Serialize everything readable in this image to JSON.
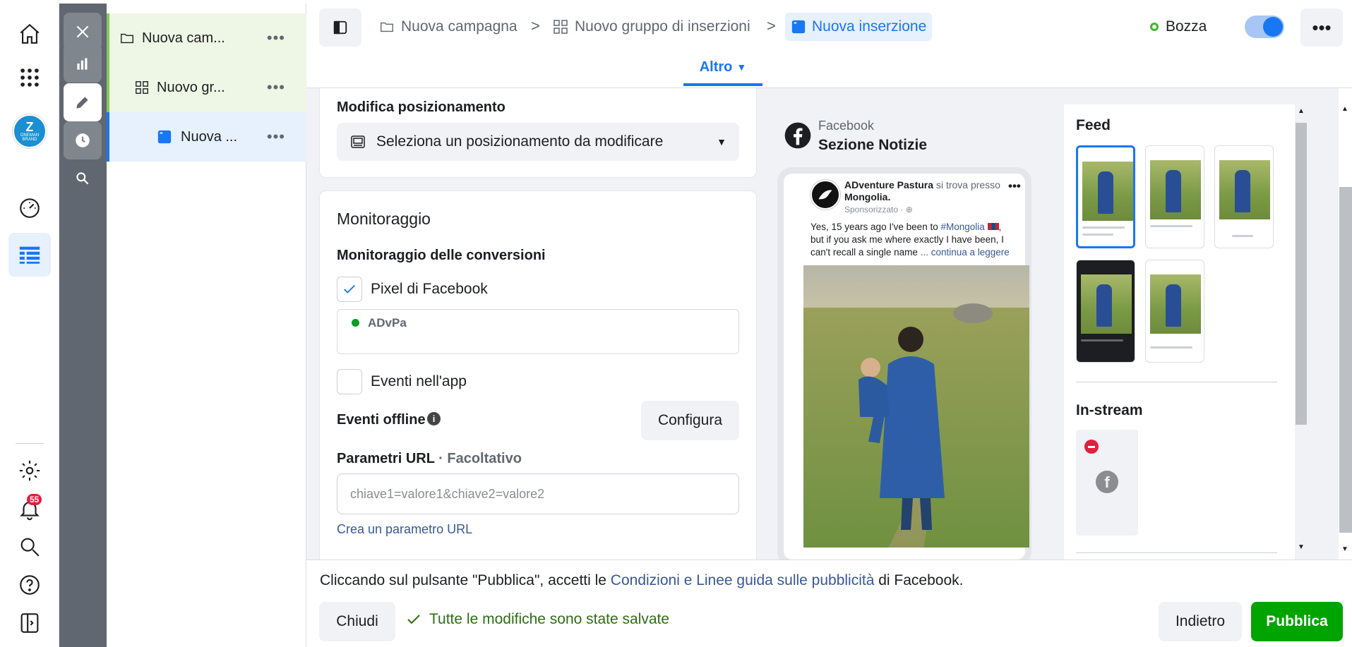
{
  "colors": {
    "accent": "#1877f2",
    "publish": "#00a400",
    "saved": "#2d6e13",
    "badge": "#e41e3f"
  },
  "rail": {
    "badge_count": "55",
    "avatar_line1": "Z",
    "avatar_line2": "ONEMAN",
    "avatar_line3": "BRAND"
  },
  "tree": {
    "items": [
      {
        "label": "Nuova cam...",
        "icon": "folder-icon"
      },
      {
        "label": "Nuovo gr...",
        "icon": "grid-icon"
      },
      {
        "label": "Nuova ...",
        "icon": "ad-icon"
      }
    ]
  },
  "breadcrumb": {
    "campaign": "Nuova campagna",
    "adset": "Nuovo gruppo di inserzioni",
    "ad": "Nuova inserzione",
    "separator": ">"
  },
  "status": {
    "label": "Bozza",
    "more": "•••"
  },
  "tab": {
    "label": "Altro"
  },
  "placement": {
    "heading": "Modifica posizionamento",
    "select_value": "Seleziona un posizionamento da modificare"
  },
  "tracking": {
    "heading": "Monitoraggio",
    "conversion_heading": "Monitoraggio delle conversioni",
    "pixel_label": "Pixel di Facebook",
    "pixel_name": "ADvPa",
    "app_events_label": "Eventi nell'app",
    "offline_label": "Eventi offline",
    "configure_label": "Configura",
    "url_params_label": "Parametri URL",
    "url_params_optional": "· Facoltativo",
    "url_placeholder": "chiave1=valore1&chiave2=valore2",
    "url_link": "Crea un parametro URL"
  },
  "preview": {
    "platform": "Facebook",
    "placement": "Sezione Notizie",
    "page_name": "ADventure Pastura",
    "located_text": "si trova presso",
    "location": "Mongolia",
    "sponsored": "Sponsorizzato · ",
    "post_line1": "Yes, 15 years ago I've been to ",
    "hashtag": "#Mongolia",
    "post_line2": "but if you ask me where exactly I have been, I",
    "post_line3": "can't recall a single name",
    "read_more": "... continua a leggere",
    "feed_heading": "Feed",
    "instream_heading": "In-stream"
  },
  "footer": {
    "terms_prefix": "Cliccando sul pulsante \"Pubblica\", accetti le ",
    "terms_link": "Condizioni e Linee guida sulle pubblicità",
    "terms_suffix": " di Facebook.",
    "close": "Chiudi",
    "saved": "Tutte le modifiche sono state salvate",
    "back": "Indietro",
    "publish": "Pubblica"
  }
}
